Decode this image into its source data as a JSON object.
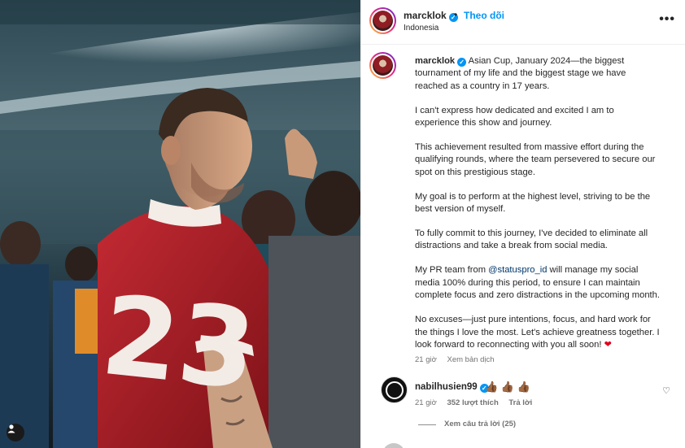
{
  "header": {
    "username": "marcklok",
    "dot": "•",
    "follow_label": "Theo dõi",
    "location": "Indonesia",
    "more_label": "•••"
  },
  "post": {
    "username": "marcklok",
    "paragraphs": [
      "Asian Cup, January 2024—the biggest tournament of my life and the biggest stage we have reached as a country in 17 years.",
      "I can't express how dedicated and excited I am to experience this show and journey.",
      "This achievement resulted from massive effort during the qualifying rounds, where the team persevered to secure our spot on this prestigious stage.",
      "My goal is to perform at the highest level, striving to be the best version of myself.",
      "To fully commit to this journey, I've decided to eliminate all distractions and take a break from social media."
    ],
    "pr_before": "My PR team from ",
    "pr_mention": "@statuspro_id",
    "pr_after": " will manage my social media 100% during this period, to ensure I can maintain complete focus and zero distractions in the upcoming month.",
    "last_paragraph": "No excuses—just pure intentions, focus, and hard work for the things I love the most. Let's achieve greatness together. I look forward to reconnecting with you all soon!",
    "heart_emoji": "❤",
    "time": "21 giờ",
    "see_translation": "Xem bản dịch"
  },
  "comment": {
    "username": "nabilhusien99",
    "text": "👍🏾 👍🏾 👍🏾",
    "time": "21 giờ",
    "likes": "352 lượt thích",
    "reply": "Trả lời",
    "view_replies": "Xem câu trả lời (25)"
  },
  "photo": {
    "jersey_number": "23"
  },
  "colors": {
    "accent": "#0095f6",
    "jersey": "#b2232b",
    "heart": "#e0001b"
  }
}
